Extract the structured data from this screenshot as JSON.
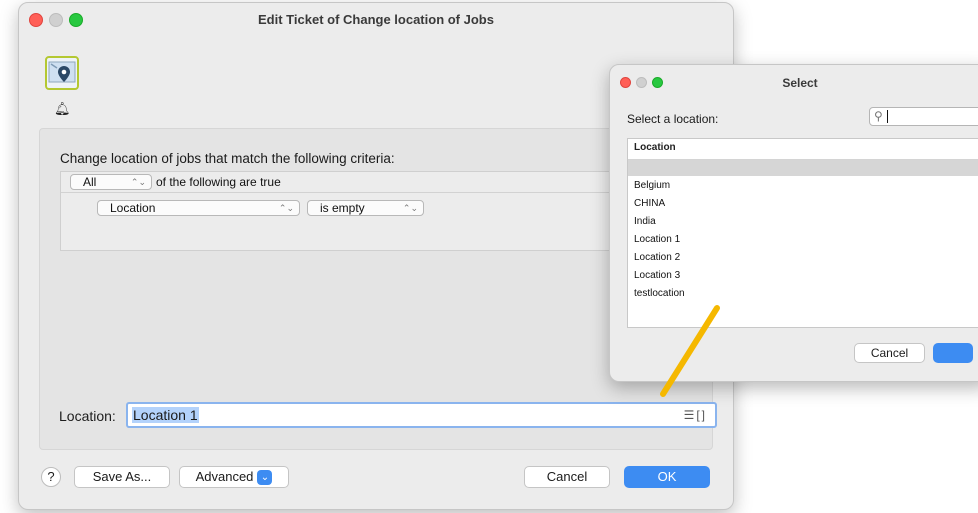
{
  "main_window": {
    "title": "Edit Ticket of Change location of Jobs",
    "criteria_label": "Change location of jobs that match the following criteria:",
    "match_select_value": "All",
    "match_suffix": "of the following are true",
    "field_select_value": "Location",
    "operator_select_value": "is empty",
    "location_label": "Location:",
    "location_value": "Location 1",
    "buttons": {
      "help": "?",
      "save_as": "Save As...",
      "advanced": "Advanced",
      "cancel": "Cancel",
      "ok": "OK"
    }
  },
  "select_dialog": {
    "title": "Select",
    "prompt": "Select a location:",
    "search_value": "",
    "list_header": "Location",
    "items": [
      "Belgium",
      "CHINA",
      "India",
      "Location 1",
      "Location 2",
      "Location 3",
      "testlocation"
    ],
    "cancel_label": "Cancel"
  },
  "colors": {
    "accent": "#3d8cf2",
    "annotation_arrow": "#f5b800",
    "selection": "#b3d2fb"
  },
  "icons": [
    "location-pin-icon",
    "bell-icon",
    "search-icon",
    "list-icon",
    "brackets-icon",
    "chevron-updown-icon",
    "chevron-down-icon"
  ]
}
